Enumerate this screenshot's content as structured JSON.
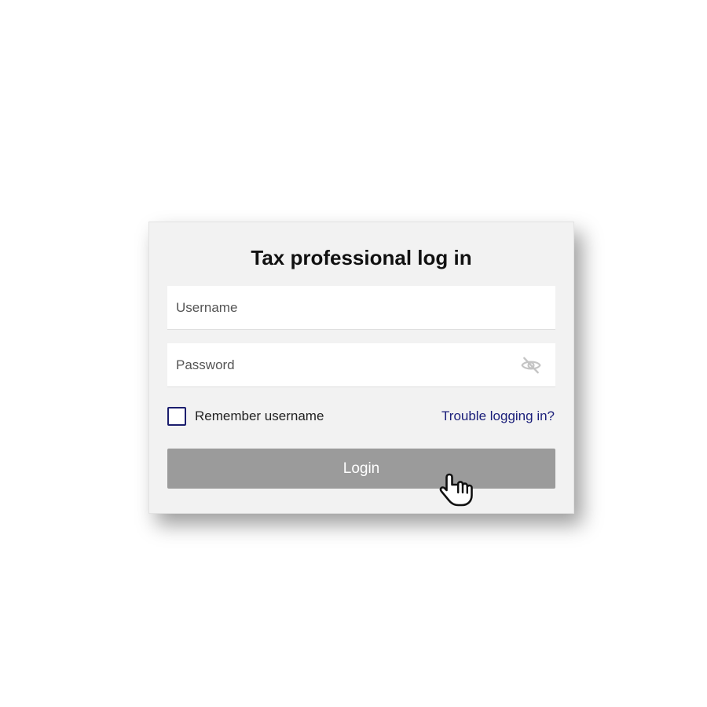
{
  "login_card": {
    "title": "Tax professional log in",
    "username": {
      "placeholder": "Username",
      "value": ""
    },
    "password": {
      "placeholder": "Password",
      "value": "",
      "toggle_icon": "eye-slash-icon"
    },
    "remember": {
      "label": "Remember username",
      "checked": false
    },
    "trouble_link": "Trouble logging in?",
    "login_button": "Login"
  },
  "colors": {
    "card_background": "#f2f2f2",
    "button_disabled": "#9b9b9b",
    "link": "#1b1f7a",
    "checkbox_border": "#1b1e6e"
  },
  "cursor": {
    "icon": "hand-pointer-icon"
  }
}
